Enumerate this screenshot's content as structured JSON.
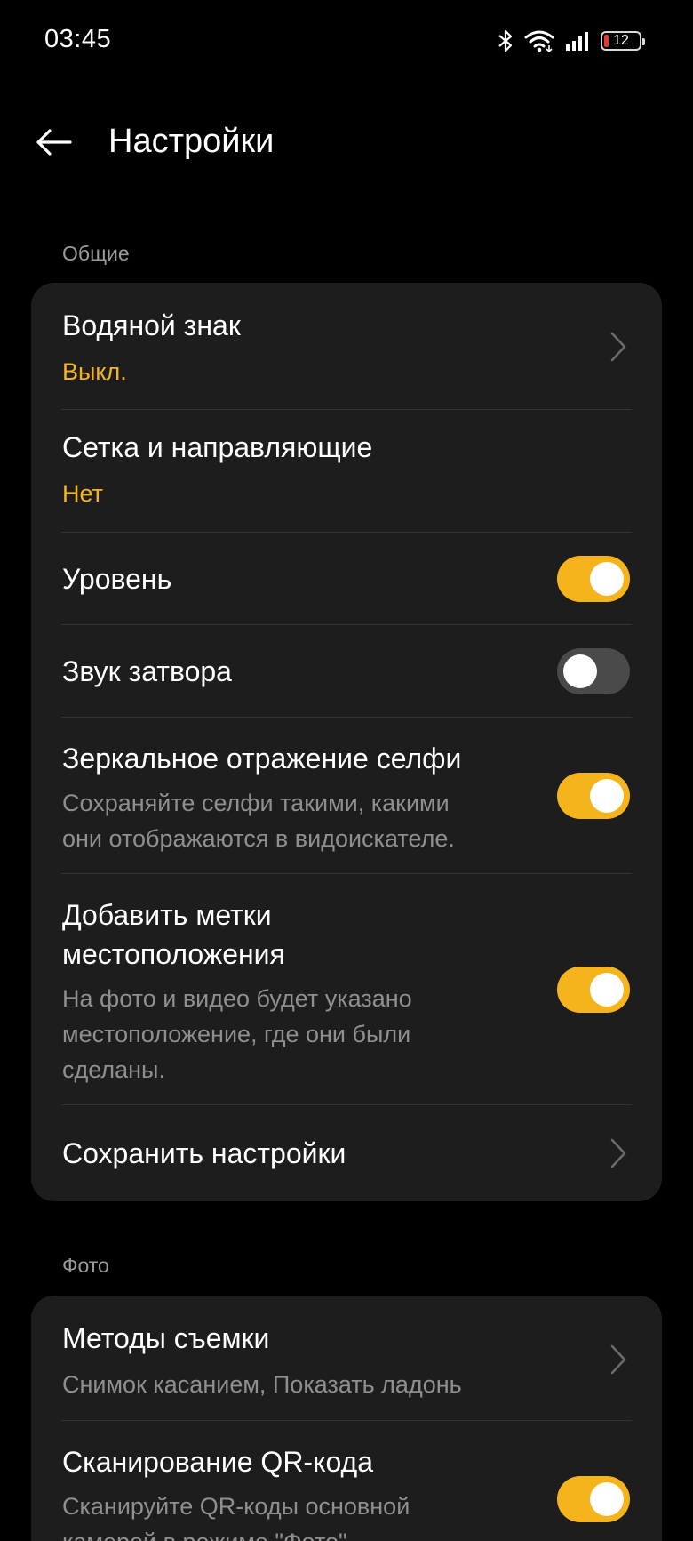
{
  "status_bar": {
    "time": "03:45",
    "icons": [
      "bluetooth-icon",
      "wifi-icon",
      "signal-icon",
      "battery-icon"
    ],
    "battery_level": "12",
    "battery_color": "#e53935"
  },
  "header": {
    "back_icon": "arrow-left-icon",
    "title": "Настройки"
  },
  "colors": {
    "background": "#000000",
    "card": "#1d1d1d",
    "accent": "#f5b31c",
    "toggle_off": "#4a4a4a",
    "secondary_text": "#8f8f8f"
  },
  "general": {
    "label": "Общие",
    "watermark": {
      "title": "Водяной знак",
      "value": "Выкл."
    },
    "grid": {
      "title": "Сетка и направляющие",
      "value": "Нет"
    },
    "level": {
      "title": "Уровень",
      "enabled": true
    },
    "shutter_sound": {
      "title": "Звук затвора",
      "enabled": false
    },
    "mirror_selfie": {
      "title": "Зеркальное отражение селфи",
      "desc_line1": "Сохраняйте селфи такими, какими",
      "desc_line2": "они отображаются в видоискателе.",
      "enabled": true
    },
    "location_tags": {
      "title_line1": "Добавить метки",
      "title_line2": "местоположения",
      "desc_line1": "На фото и видео будет указано",
      "desc_line2": "местоположение, где они были",
      "desc_line3": "сделаны.",
      "enabled": true
    },
    "save_settings": {
      "title": "Сохранить настройки"
    }
  },
  "photo": {
    "label": "Фото",
    "shooting_methods": {
      "title": "Методы съемки",
      "value": "Снимок касанием, Показать ладонь"
    },
    "qr_scan": {
      "title": "Сканирование QR-кода",
      "desc_line1": "Сканируйте QR-коды основной",
      "desc_line2": "камерой в режиме \"Фото\".",
      "enabled": true
    }
  }
}
